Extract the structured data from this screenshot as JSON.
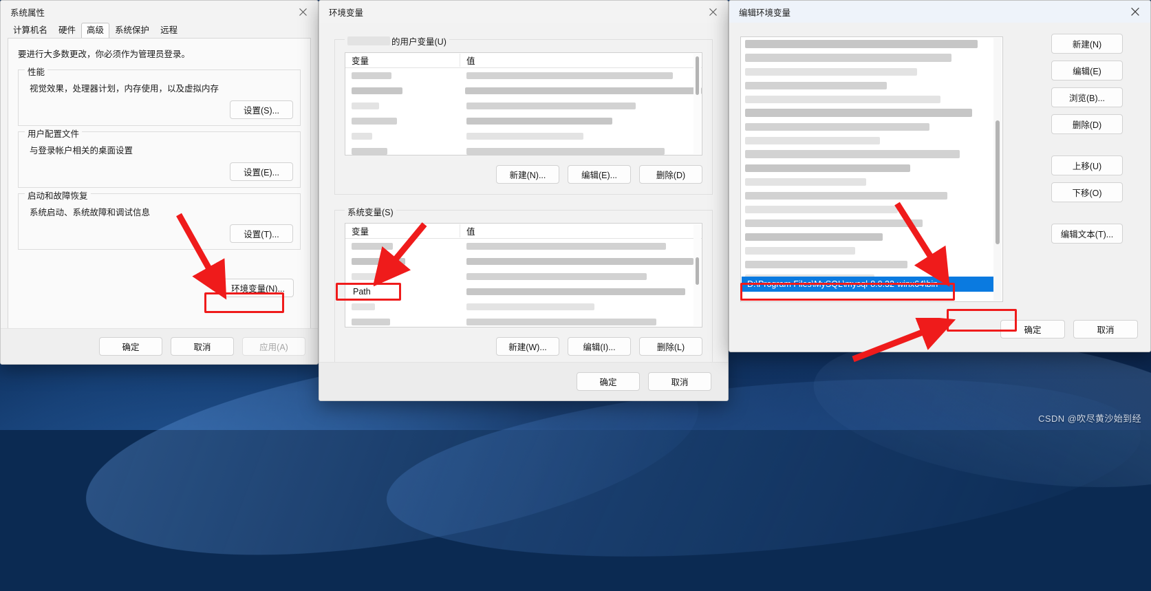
{
  "desktop": {
    "watermark": "CSDN @吹尽黄沙始到经"
  },
  "system_properties": {
    "title": "系统属性",
    "close_icon": "close-icon",
    "tabs": [
      {
        "label": "计算机名",
        "active": false
      },
      {
        "label": "硬件",
        "active": false
      },
      {
        "label": "高级",
        "active": true
      },
      {
        "label": "系统保护",
        "active": false
      },
      {
        "label": "远程",
        "active": false
      }
    ],
    "admin_note": "要进行大多数更改，你必须作为管理员登录。",
    "groups": [
      {
        "legend": "性能",
        "desc": "视觉效果，处理器计划，内存使用，以及虚拟内存",
        "button": "设置(S)..."
      },
      {
        "legend": "用户配置文件",
        "desc": "与登录帐户相关的桌面设置",
        "button": "设置(E)..."
      },
      {
        "legend": "启动和故障恢复",
        "desc": "系统启动、系统故障和调试信息",
        "button": "设置(T)..."
      }
    ],
    "env_button": "环境变量(N)...",
    "footer": {
      "ok": "确定",
      "cancel": "取消",
      "apply": "应用(A)",
      "apply_disabled": true
    }
  },
  "environment_variables": {
    "title": "环境变量",
    "close_icon": "close-icon",
    "user_group": {
      "legend_suffix": "的用户变量(U)",
      "columns": {
        "variable": "变量",
        "value": "值"
      },
      "buttons": {
        "new": "新建(N)...",
        "edit": "编辑(E)...",
        "delete": "删除(D)"
      }
    },
    "system_group": {
      "legend": "系统变量(S)",
      "columns": {
        "variable": "变量",
        "value": "值"
      },
      "path_row_label": "Path",
      "buttons": {
        "new": "新建(W)...",
        "edit": "编辑(I)...",
        "delete": "删除(L)"
      }
    },
    "footer": {
      "ok": "确定",
      "cancel": "取消"
    }
  },
  "edit_environment_variable": {
    "title": "编辑环境变量",
    "close_icon": "close-icon",
    "selected_path": "D:\\Program Files\\MySQL\\mysql-8.0.32-winx64\\bin",
    "side_buttons": [
      "新建(N)",
      "编辑(E)",
      "浏览(B)...",
      "删除(D)",
      "上移(U)",
      "下移(O)",
      "编辑文本(T)..."
    ],
    "footer": {
      "ok": "确定",
      "cancel": "取消"
    }
  },
  "annotations": {
    "accent_red": "#ef1b1b",
    "highlight_blue": "#0a7ae0",
    "arrows": [
      {
        "name": "arrow-to-env-button"
      },
      {
        "name": "arrow-to-path-row"
      },
      {
        "name": "arrow-to-selected-path"
      },
      {
        "name": "arrow-to-ok-button"
      }
    ],
    "boxes": [
      {
        "name": "box-env-button"
      },
      {
        "name": "box-path-row"
      },
      {
        "name": "box-selected-path"
      },
      {
        "name": "box-ok-button"
      }
    ]
  }
}
